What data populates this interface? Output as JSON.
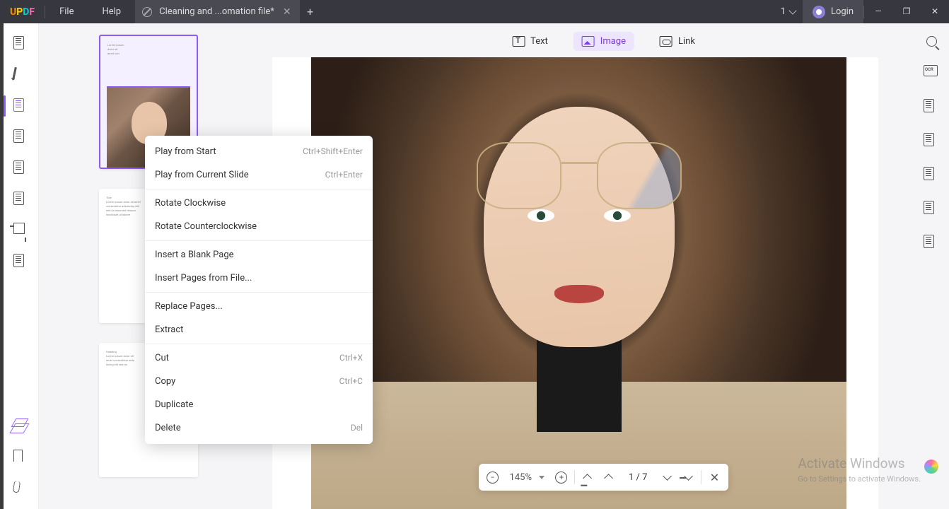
{
  "titlebar": {
    "logo_letters": [
      "U",
      "P",
      "D",
      "F"
    ],
    "menu_file": "File",
    "menu_help": "Help",
    "tab_title": "Cleaning and ...omation file*",
    "tab_count": "1",
    "login": "Login"
  },
  "top_tools": {
    "text": "Text",
    "image": "Image",
    "link": "Link"
  },
  "context_menu": {
    "items": [
      {
        "label": "Play from Start",
        "shortcut": "Ctrl+Shift+Enter"
      },
      {
        "label": "Play from Current Slide",
        "shortcut": "Ctrl+Enter"
      },
      {
        "label": "Rotate Clockwise",
        "shortcut": ""
      },
      {
        "label": "Rotate Counterclockwise",
        "shortcut": ""
      },
      {
        "label": "Insert a Blank Page",
        "shortcut": ""
      },
      {
        "label": "Insert Pages from File...",
        "shortcut": ""
      },
      {
        "label": "Replace Pages...",
        "shortcut": ""
      },
      {
        "label": "Extract",
        "shortcut": ""
      },
      {
        "label": "Cut",
        "shortcut": "Ctrl+X"
      },
      {
        "label": "Copy",
        "shortcut": "Ctrl+C"
      },
      {
        "label": "Duplicate",
        "shortcut": ""
      },
      {
        "label": "Delete",
        "shortcut": "Del"
      }
    ]
  },
  "page_nav": {
    "zoom": "145%",
    "current": "1",
    "sep": "/",
    "total": "7"
  },
  "watermark": {
    "title": "Activate Windows",
    "sub": "Go to Settings to activate Windows."
  }
}
